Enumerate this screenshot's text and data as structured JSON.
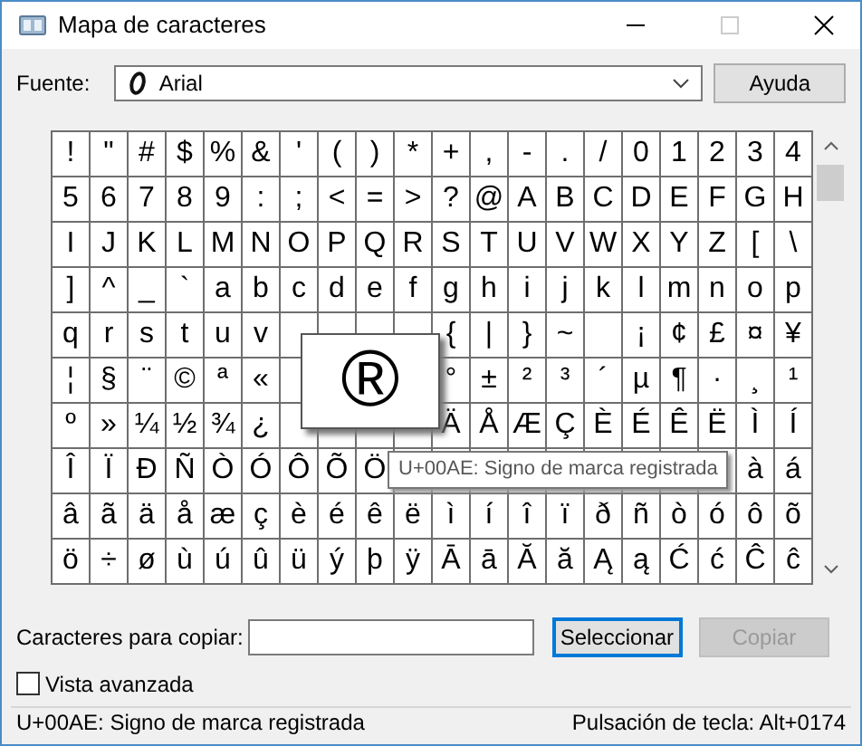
{
  "window": {
    "title": "Mapa de caracteres"
  },
  "font": {
    "label": "Fuente:",
    "value": "Arial"
  },
  "help_button": "Ayuda",
  "grid": {
    "rows": [
      [
        "!",
        "\"",
        "#",
        "$",
        "%",
        "&",
        "'",
        "(",
        ")",
        "*",
        "+",
        ",",
        "-",
        ".",
        "/",
        "0",
        "1",
        "2",
        "3",
        "4"
      ],
      [
        "5",
        "6",
        "7",
        "8",
        "9",
        ":",
        ";",
        "<",
        "=",
        ">",
        "?",
        "@",
        "A",
        "B",
        "C",
        "D",
        "E",
        "F",
        "G",
        "H"
      ],
      [
        "I",
        "J",
        "K",
        "L",
        "M",
        "N",
        "O",
        "P",
        "Q",
        "R",
        "S",
        "T",
        "U",
        "V",
        "W",
        "X",
        "Y",
        "Z",
        "[",
        "\\"
      ],
      [
        "]",
        "^",
        "_",
        "`",
        "a",
        "b",
        "c",
        "d",
        "e",
        "f",
        "g",
        "h",
        "i",
        "j",
        "k",
        "l",
        "m",
        "n",
        "o",
        "p"
      ],
      [
        "q",
        "r",
        "s",
        "t",
        "u",
        "v",
        null,
        null,
        null,
        null,
        "{",
        "|",
        "}",
        "~",
        null,
        "¡",
        "¢",
        "£",
        "¤",
        "¥"
      ],
      [
        "¦",
        "§",
        "¨",
        "©",
        "ª",
        "«",
        null,
        null,
        null,
        null,
        "°",
        "±",
        "²",
        "³",
        "´",
        "µ",
        "¶",
        "·",
        "¸",
        "¹"
      ],
      [
        "º",
        "»",
        "¼",
        "½",
        "¾",
        "¿",
        null,
        null,
        null,
        null,
        "Ä",
        "Å",
        "Æ",
        "Ç",
        "È",
        "É",
        "Ê",
        "Ë",
        "Ì",
        "Í"
      ],
      [
        "Î",
        "Ï",
        "Ð",
        "Ñ",
        "Ò",
        "Ó",
        "Ô",
        "Õ",
        "Ö",
        null,
        null,
        null,
        null,
        null,
        null,
        null,
        null,
        null,
        "à",
        "á"
      ],
      [
        "â",
        "ã",
        "ä",
        "å",
        "æ",
        "ç",
        "è",
        "é",
        "ê",
        "ë",
        "ì",
        "í",
        "î",
        "ï",
        "ð",
        "ñ",
        "ò",
        "ó",
        "ô",
        "õ"
      ],
      [
        "ö",
        "÷",
        "ø",
        "ù",
        "ú",
        "û",
        "ü",
        "ý",
        "þ",
        "ÿ",
        "Ā",
        "ā",
        "Ă",
        "ă",
        "Ą",
        "ą",
        "Ć",
        "ć",
        "Ĉ",
        "ĉ"
      ]
    ]
  },
  "magnified": "®",
  "tooltip": "U+00AE: Signo de marca registrada",
  "copy": {
    "label": "Caracteres para copiar:"
  },
  "buttons": [
    {
      "label": "Seleccionar",
      "disabled": false,
      "focused": true
    },
    {
      "label": "Copiar",
      "disabled": true,
      "focused": false
    }
  ],
  "advanced": {
    "label": "Vista avanzada",
    "checked": false
  },
  "status_bar": {
    "description": "U+00AE: Signo de marca registrada",
    "keystroke": "Pulsación de tecla: Alt+0174"
  }
}
